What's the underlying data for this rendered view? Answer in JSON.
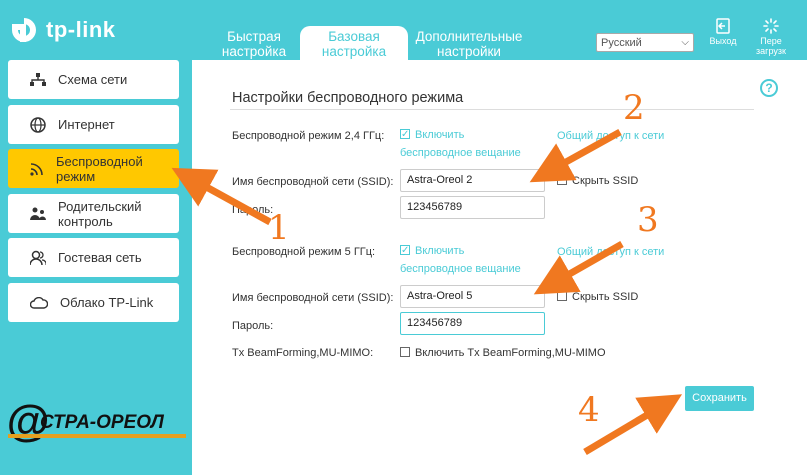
{
  "brand": {
    "name": "tp-link",
    "accent": "#4acbd6",
    "active": "#ffc800"
  },
  "tabs": [
    {
      "label": "Быстрая настройка",
      "active": false
    },
    {
      "label": "Базовая настройка",
      "active": true
    },
    {
      "label": "Дополнительные настройки",
      "active": false
    }
  ],
  "language": {
    "selected": "Русский"
  },
  "header_actions": {
    "logout": "Выход",
    "reboot": "Пере загрузк"
  },
  "sidebar": {
    "items": [
      {
        "label": "Схема сети",
        "icon": "network-map-icon"
      },
      {
        "label": "Интернет",
        "icon": "globe-icon"
      },
      {
        "label": "Беспроводной режим",
        "icon": "wifi-icon",
        "active": true
      },
      {
        "label": "Родительский контроль",
        "icon": "parental-icon"
      },
      {
        "label": "Гостевая сеть",
        "icon": "guest-icon"
      },
      {
        "label": "Облако TP-Link",
        "icon": "cloud-icon"
      }
    ]
  },
  "main": {
    "title": "Настройки беспроводного режима",
    "help": "?",
    "band24": {
      "label": "Беспроводной режим 2,4 ГГц:",
      "enable": "Включить",
      "broadcast": "беспроводное вещание",
      "share": "Общий доступ к сети",
      "ssid_label": "Имя беспроводной сети (SSID):",
      "ssid": "Astra-Oreol 2",
      "hide_ssid": "Скрыть SSID",
      "pass_label": "Пароль:",
      "password": "123456789"
    },
    "band5": {
      "label": "Беспроводной режим 5 ГГц:",
      "enable": "Включить",
      "broadcast": "беспроводное вещание",
      "share": "Общий доступ к сети",
      "ssid_label": "Имя беспроводной сети (SSID):",
      "ssid": "Astra-Oreol 5",
      "hide_ssid": "Скрыть SSID",
      "pass_label": "Пароль:",
      "password": "123456789"
    },
    "beamforming": {
      "label": "Tx BeamForming,MU-MIMO:",
      "enable": "Включить Tx BeamForming,MU-MIMO"
    },
    "save": "Сохранить"
  },
  "annotations": {
    "n1": "1",
    "n2": "2",
    "n3": "3",
    "n4": "4",
    "arrow_color": "#f07820"
  },
  "watermark": {
    "text": "СТРА-ОРЕОЛ",
    "at": "@"
  }
}
